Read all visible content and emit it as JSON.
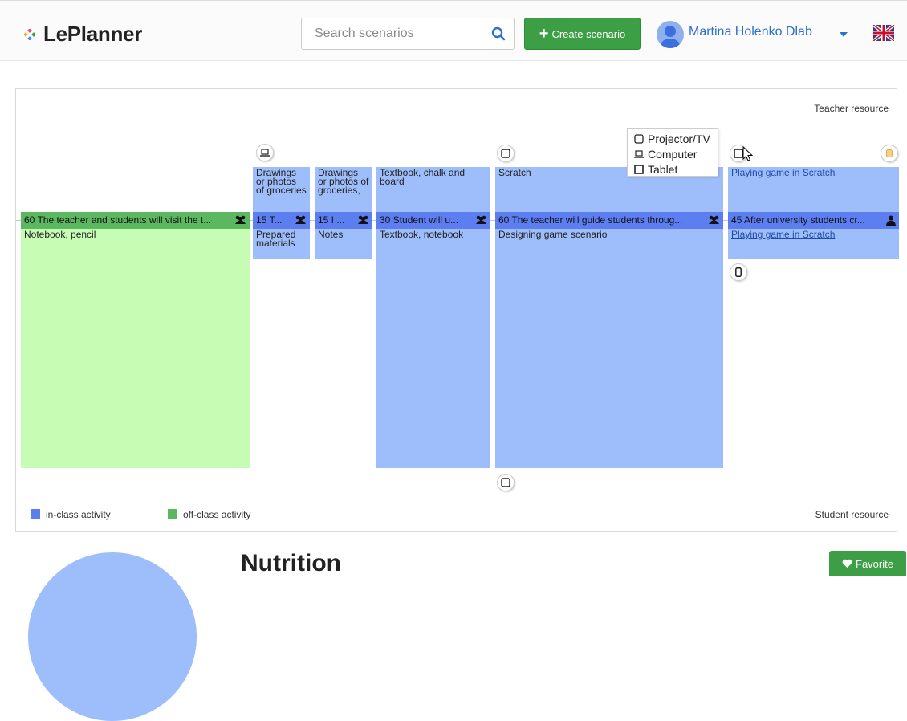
{
  "header": {
    "app_name": "LePlanner",
    "search_placeholder": "Search scenarios",
    "create_label": "Create scenario",
    "user_name": "Martina Holenko Dlab"
  },
  "timeline": {
    "teacher_resource_label": "Teacher resource",
    "student_resource_label": "Student resource",
    "activities": [
      {
        "bar_text": "60 The teacher and students will visit the t...",
        "type": "off-class",
        "teacher_text": "",
        "student_text": "Notebook, pencil"
      },
      {
        "bar_text": "15 T...",
        "type": "in-class",
        "teacher_text": "Drawings or photos of groceries",
        "student_text": "Prepared materials"
      },
      {
        "bar_text": "15 I ...",
        "type": "in-class",
        "teacher_text": "Drawings or photos of groceries,",
        "student_text": "Notes"
      },
      {
        "bar_text": "30 Student will u...",
        "type": "in-class",
        "teacher_text": "Textbook, chalk and board",
        "student_text": "Textbook, notebook"
      },
      {
        "bar_text": "60 The teacher will guide students throug...",
        "type": "in-class",
        "teacher_text": "Scratch",
        "student_text": "Designing game scenario"
      },
      {
        "bar_text": "45 After university students cr...",
        "type": "in-class",
        "teacher_text": "Playing game in Scratch",
        "student_text": "Playing game in Scratch"
      }
    ],
    "tooltip_items": [
      "Projector/TV",
      "Computer",
      "Tablet"
    ],
    "legend": {
      "in_class": "in-class activity",
      "off_class": "off-class activity"
    },
    "colors": {
      "in_class": "#5c7ef0",
      "off_class": "#5cb860",
      "in_class_bg": "#9ebefb",
      "off_class_bg": "#c6fcb4"
    }
  },
  "scenario": {
    "title": "Nutrition",
    "favorite_label": "Favorite"
  },
  "icons": [
    "search-icon",
    "plus-icon",
    "avatar",
    "chevron-down-icon",
    "uk-flag-icon",
    "computer-icon",
    "projector-icon",
    "tablet-icon",
    "phone-icon",
    "document-icon",
    "group-icon",
    "person-icon",
    "heart-icon",
    "cursor-icon"
  ]
}
